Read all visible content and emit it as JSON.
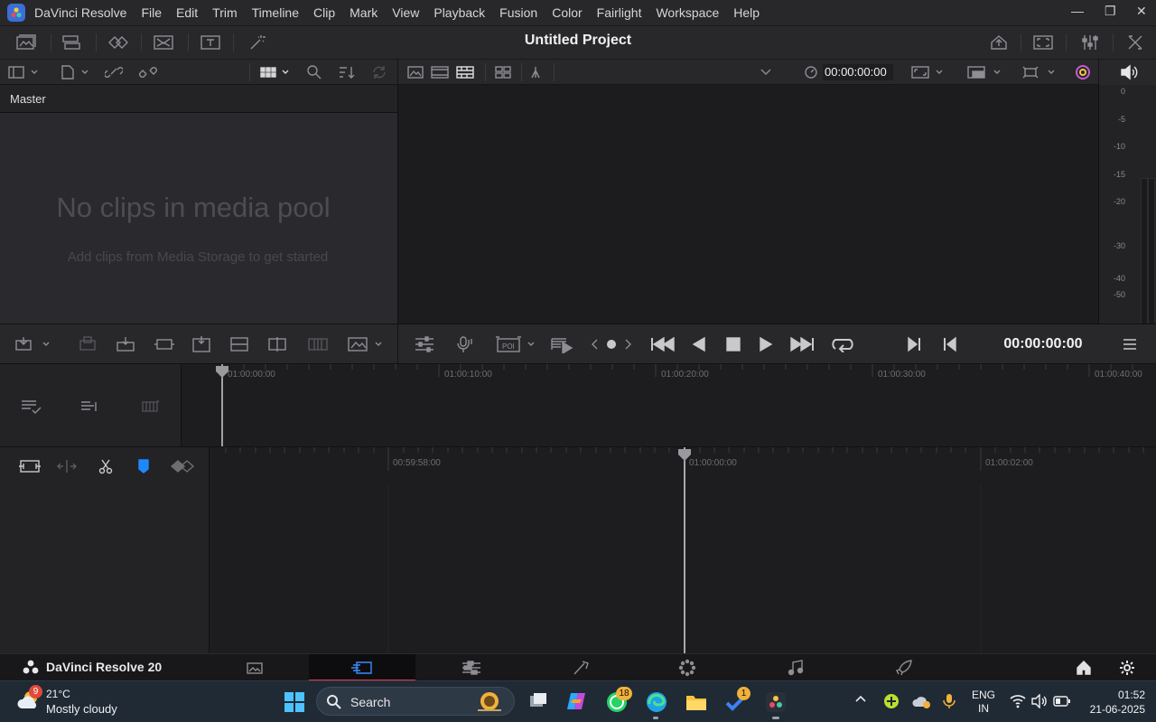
{
  "app": {
    "name": "DaVinci Resolve",
    "menu": [
      "File",
      "Edit",
      "Trim",
      "Timeline",
      "Clip",
      "Mark",
      "View",
      "Playback",
      "Fusion",
      "Color",
      "Fairlight",
      "Workspace",
      "Help"
    ]
  },
  "toolbar": {
    "project_title": "Untitled Project"
  },
  "media_pool": {
    "header": "Master",
    "empty_title": "No clips in media pool",
    "empty_subtitle": "Add clips from Media Storage to get started"
  },
  "viewer": {
    "timecode": "00:00:00:00"
  },
  "audio_meter": {
    "labels": [
      "0",
      "-5",
      "-10",
      "-15",
      "-20",
      "-30",
      "-40",
      "-50"
    ]
  },
  "transport": {
    "timecode": "00:00:00:00"
  },
  "upper_timeline": {
    "ruler": [
      "01:00:00:00",
      "01:00:10:00",
      "01:00:20:00",
      "01:00:30:00",
      "01:00:40:00"
    ]
  },
  "lower_timeline": {
    "ruler": [
      "00:59:58:00",
      "01:00:00:00",
      "01:00:02:00"
    ]
  },
  "page_bar": {
    "brand": "DaVinci Resolve 20",
    "pages": [
      "media-page",
      "cut-page",
      "edit-page",
      "fusion-page",
      "color-page",
      "fairlight-page",
      "deliver-page"
    ],
    "active_page": "cut-page"
  },
  "taskbar": {
    "weather_temp": "21°C",
    "weather_desc": "Mostly cloudy",
    "weather_badge": "9",
    "search_label": "Search",
    "whatsapp_badge": "18",
    "todo_badge": "1",
    "lang_line1": "ENG",
    "lang_line2": "IN",
    "time": "01:52",
    "date": "21-06-2025"
  },
  "colors": {
    "accent": "#e03a44",
    "active_blue": "#1e88ff",
    "background": "#1f1f22"
  }
}
